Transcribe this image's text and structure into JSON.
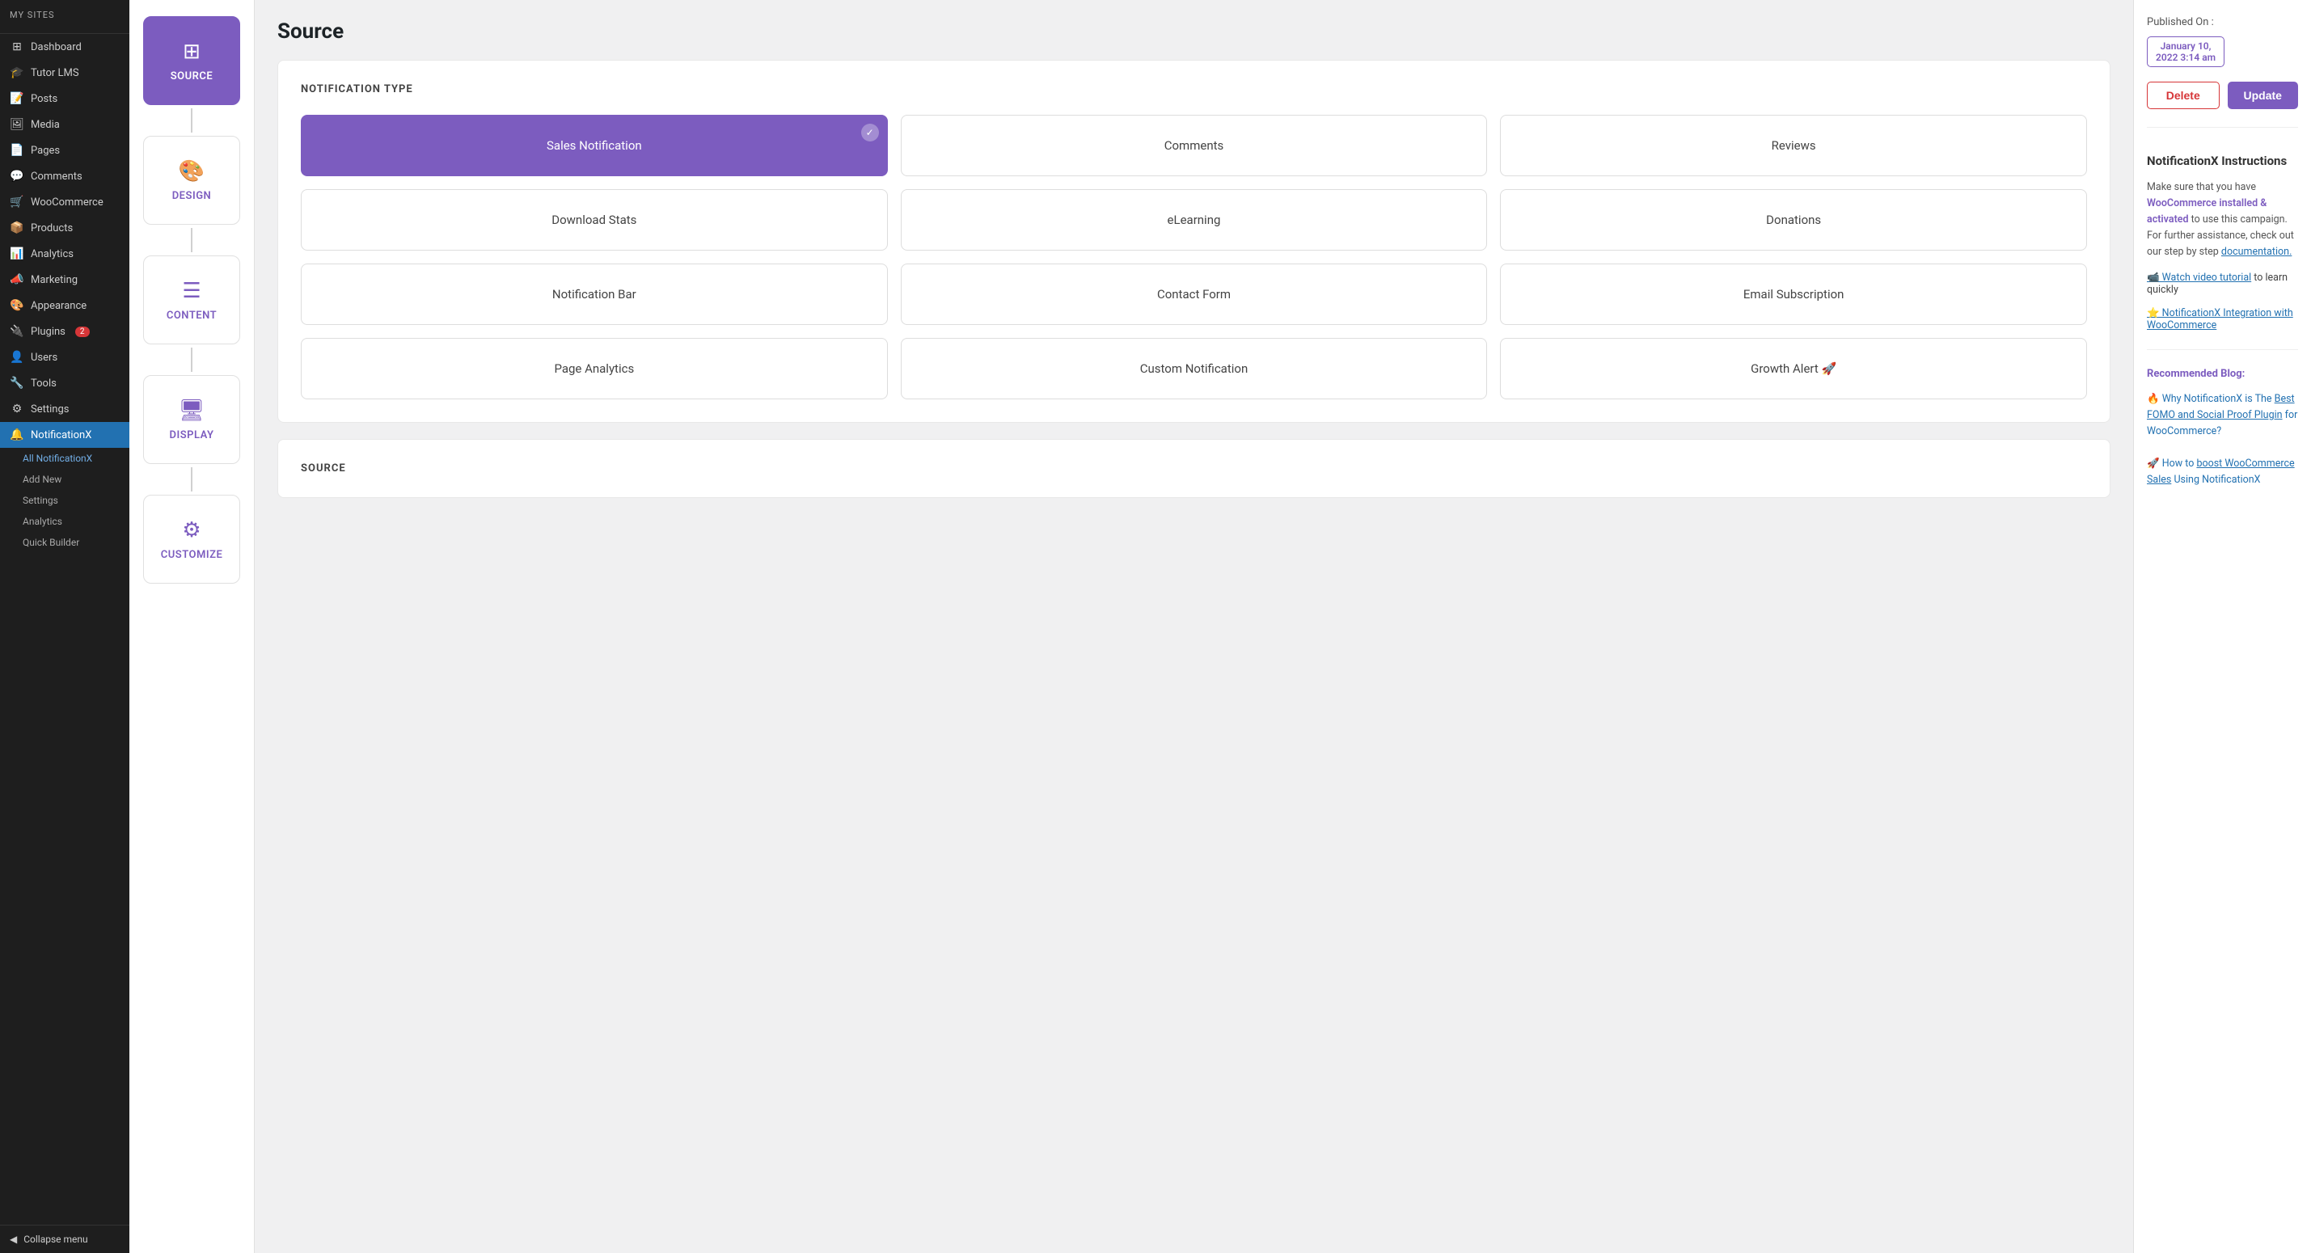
{
  "sidebar": {
    "items": [
      {
        "id": "dashboard",
        "label": "Dashboard",
        "icon": "⊞"
      },
      {
        "id": "tutor-lms",
        "label": "Tutor LMS",
        "icon": "🎓"
      },
      {
        "id": "posts",
        "label": "Posts",
        "icon": "📝"
      },
      {
        "id": "media",
        "label": "Media",
        "icon": "🖼"
      },
      {
        "id": "pages",
        "label": "Pages",
        "icon": "📄"
      },
      {
        "id": "comments",
        "label": "Comments",
        "icon": "💬"
      },
      {
        "id": "woocommerce",
        "label": "WooCommerce",
        "icon": "🛒"
      },
      {
        "id": "products",
        "label": "Products",
        "icon": "📦"
      },
      {
        "id": "analytics",
        "label": "Analytics",
        "icon": "📊"
      },
      {
        "id": "marketing",
        "label": "Marketing",
        "icon": "📣"
      },
      {
        "id": "appearance",
        "label": "Appearance",
        "icon": "🎨"
      },
      {
        "id": "plugins",
        "label": "Plugins",
        "icon": "🔌",
        "badge": "2"
      },
      {
        "id": "users",
        "label": "Users",
        "icon": "👤"
      },
      {
        "id": "tools",
        "label": "Tools",
        "icon": "🔧"
      },
      {
        "id": "settings",
        "label": "Settings",
        "icon": "⚙"
      },
      {
        "id": "notificationx",
        "label": "NotificationX",
        "icon": "🔔",
        "active": true
      }
    ],
    "sub_items": [
      {
        "id": "all-notificationx",
        "label": "All NotificationX",
        "active": true
      },
      {
        "id": "add-new",
        "label": "Add New"
      },
      {
        "id": "settings",
        "label": "Settings"
      },
      {
        "id": "analytics",
        "label": "Analytics"
      },
      {
        "id": "quick-builder",
        "label": "Quick Builder"
      }
    ],
    "collapse_label": "Collapse menu"
  },
  "wizard_steps": [
    {
      "id": "source",
      "label": "SOURCE",
      "icon": "⊞",
      "active": true
    },
    {
      "id": "design",
      "label": "DESIGN",
      "icon": "🎨"
    },
    {
      "id": "content",
      "label": "CONTENT",
      "icon": "☰"
    },
    {
      "id": "display",
      "label": "DISPLAY",
      "icon": "🖥"
    },
    {
      "id": "customize",
      "label": "CUSTOMIZE",
      "icon": "⚙"
    }
  ],
  "page": {
    "title": "Source"
  },
  "notification_type": {
    "section_title": "NOTIFICATION TYPE",
    "cards": [
      {
        "id": "sales-notification",
        "label": "Sales Notification",
        "selected": true
      },
      {
        "id": "comments",
        "label": "Comments",
        "selected": false
      },
      {
        "id": "reviews",
        "label": "Reviews",
        "selected": false
      },
      {
        "id": "download-stats",
        "label": "Download Stats",
        "selected": false
      },
      {
        "id": "elearning",
        "label": "eLearning",
        "selected": false
      },
      {
        "id": "donations",
        "label": "Donations",
        "selected": false
      },
      {
        "id": "notification-bar",
        "label": "Notification Bar",
        "selected": false
      },
      {
        "id": "contact-form",
        "label": "Contact Form",
        "selected": false
      },
      {
        "id": "email-subscription",
        "label": "Email Subscription",
        "selected": false
      },
      {
        "id": "page-analytics",
        "label": "Page Analytics",
        "selected": false
      },
      {
        "id": "custom-notification",
        "label": "Custom Notification",
        "selected": false
      },
      {
        "id": "growth-alert",
        "label": "Growth Alert 🚀",
        "selected": false
      }
    ]
  },
  "source_section": {
    "title": "SOURCE"
  },
  "right_panel": {
    "published_on_label": "Published On :",
    "published_on_date": "January 10,\n2022 3:14 am",
    "delete_label": "Delete",
    "update_label": "Update",
    "instructions_title": "NotificationX Instructions",
    "instructions_text": "Make sure that you have",
    "woo_link": "WooCommerce installed & activated",
    "instructions_text2": "to use this campaign. For further assistance, check out our step by step",
    "documentation_link": "documentation.",
    "watch_video_label": "📹 Watch video tutorial",
    "watch_video_text": "to learn quickly",
    "integration_label": "⭐ NotificationX Integration with WooCommerce",
    "recommended_blog_title": "Recommended Blog:",
    "blog1_emoji": "🔥",
    "blog1_pre": "Why NotificationX is The",
    "blog1_link": "Best FOMO and Social Proof Plugin",
    "blog1_post": "for WooCommerce?",
    "blog2_emoji": "🚀",
    "blog2_pre": "How to",
    "blog2_link": "boost WooCommerce Sales",
    "blog2_post": "Using NotificationX"
  }
}
